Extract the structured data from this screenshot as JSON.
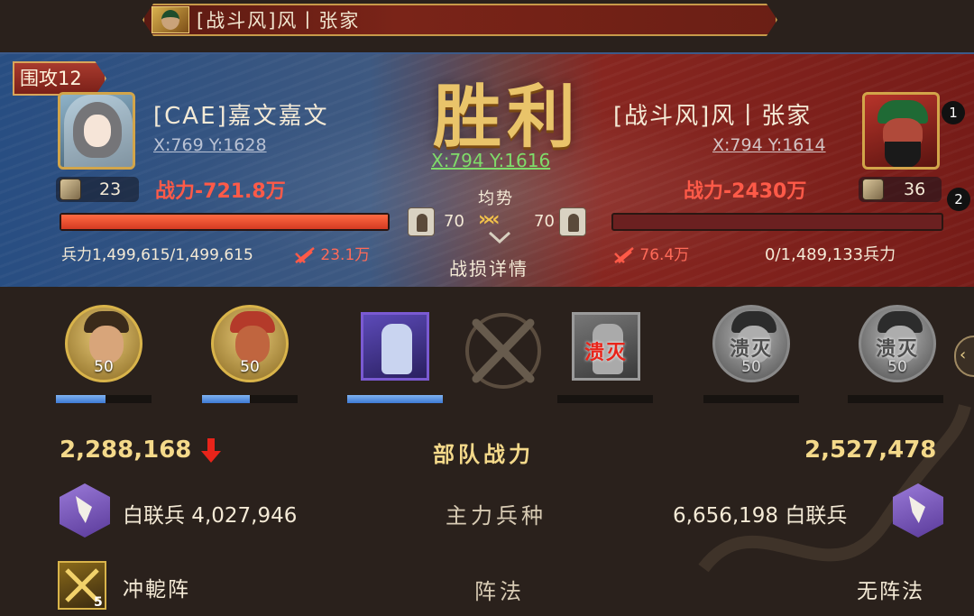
{
  "top_banner": {
    "text": "[战斗风]风丨张家"
  },
  "panel": {
    "siege_label": "围攻12",
    "result": "胜利",
    "center_coord": "X:794 Y:1616",
    "balance_label": "均势",
    "detail_label": "战损详情",
    "left": {
      "name": "[CAE]嘉文嘉文",
      "coord": "X:769 Y:1628",
      "power": "战力-721.8万",
      "level": "23",
      "morale": "70",
      "troops": "兵力1,499,615/1,499,615",
      "loss": "23.1万",
      "hp_fraction": 1.0
    },
    "right": {
      "name": "[战斗风]风丨张家",
      "coord": "X:794 Y:1614",
      "power": "战力-2430万",
      "level": "36",
      "morale": "70",
      "troops": "0/1,489,133兵力",
      "loss": "76.4万",
      "hp_fraction": 0.0
    },
    "rank_markers": [
      "1",
      "2"
    ]
  },
  "units": {
    "left": [
      {
        "type": "hero",
        "level": "50",
        "bar_fraction": 0.52
      },
      {
        "type": "hero",
        "level": "50",
        "bar_fraction": 0.5
      },
      {
        "type": "troop",
        "bar_fraction": 1.0
      }
    ],
    "right": [
      {
        "type": "troop",
        "status": "溃灭",
        "bar_fraction": 0.0
      },
      {
        "type": "hero",
        "level": "50",
        "status": "溃灭",
        "bar_fraction": 0.0
      },
      {
        "type": "hero",
        "level": "50",
        "status": "溃灭",
        "bar_fraction": 0.0
      }
    ]
  },
  "stats": {
    "force_label": "部队战力",
    "left_force": "2,288,168",
    "right_force": "2,527,478",
    "main_label": "主力兵种",
    "left_main": "白联兵 4,027,946",
    "right_main": "6,656,198 白联兵",
    "formation_label": "阵法",
    "left_formation": "冲軶阵",
    "left_formation_level": "5",
    "right_formation": "无阵法"
  },
  "colors": {
    "left_side": "#3c5a8a",
    "right_side": "#8c2620",
    "gold_text": "#f4d98a",
    "victory_gold": "#e9c46a",
    "coord_green": "#7fdc6a",
    "loss_red": "#ff5a48"
  }
}
